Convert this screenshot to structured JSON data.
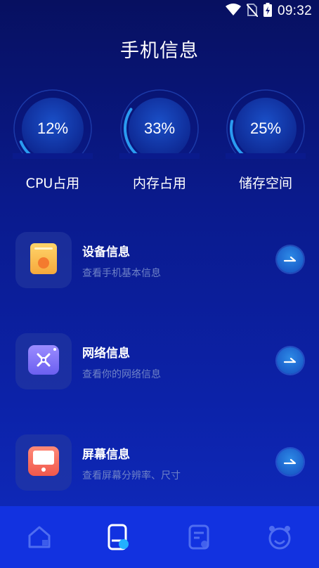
{
  "status_bar": {
    "time": "09:32",
    "icons": [
      "wifi-icon",
      "no-sim-icon",
      "battery-charging-icon"
    ]
  },
  "page": {
    "title": "手机信息"
  },
  "gauges": [
    {
      "value": "12%",
      "percent": 12,
      "label": "CPU占用"
    },
    {
      "value": "33%",
      "percent": 33,
      "label": "内存占用"
    },
    {
      "value": "25%",
      "percent": 25,
      "label": "储存空间"
    }
  ],
  "items": [
    {
      "title": "设备信息",
      "subtitle": "查看手机基本信息",
      "icon": "device-icon"
    },
    {
      "title": "网络信息",
      "subtitle": "查看你的网络信息",
      "icon": "network-icon"
    },
    {
      "title": "屏幕信息",
      "subtitle": "查看屏幕分辨率、尺寸",
      "icon": "screen-icon"
    }
  ],
  "bottom_nav": {
    "tabs": [
      "home-icon",
      "phone-info-icon",
      "notes-icon",
      "alarm-clock-icon"
    ],
    "active_tab": 1
  },
  "colors": {
    "accent": "#1e90ff",
    "nav_bg": "#1232e0",
    "subtitle": "#6f82c7"
  }
}
